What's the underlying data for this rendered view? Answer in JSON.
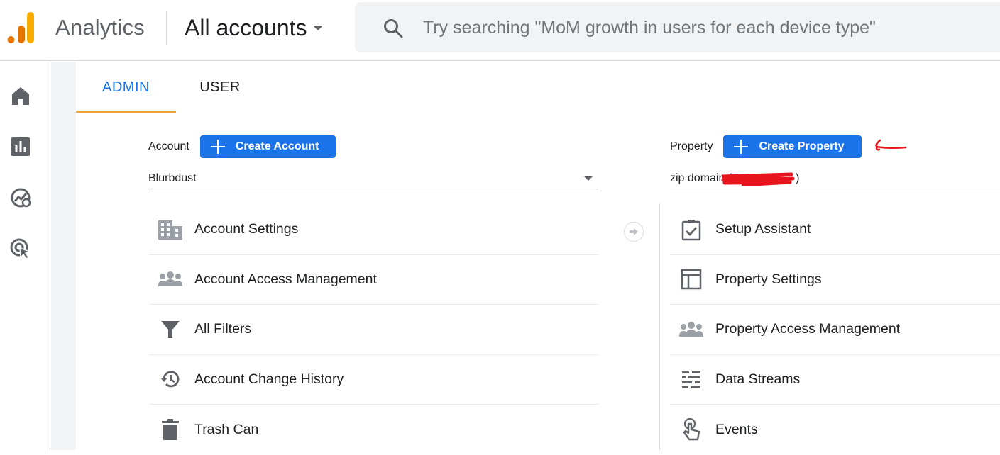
{
  "app": {
    "title": "Analytics",
    "account_picker": "All accounts",
    "search_placeholder": "Try searching \"MoM growth in users for each device type\"",
    "accent_color": "#1a73e8",
    "logo_colors": [
      "#f9ab00",
      "#e37400"
    ]
  },
  "rail": {
    "items": [
      {
        "icon": "home-icon"
      },
      {
        "icon": "reports-icon"
      },
      {
        "icon": "explore-icon"
      },
      {
        "icon": "advertising-icon"
      }
    ]
  },
  "tabs": {
    "admin": "ADMIN",
    "user": "USER",
    "active": "ADMIN"
  },
  "account": {
    "caption": "Account",
    "create_label": "Create Account",
    "selected": "Blurbdust",
    "items": [
      {
        "label": "Account Settings",
        "icon": "building-icon"
      },
      {
        "label": "Account Access Management",
        "icon": "people-icon"
      },
      {
        "label": "All Filters",
        "icon": "filter-icon"
      },
      {
        "label": "Account Change History",
        "icon": "history-icon"
      },
      {
        "label": "Trash Can",
        "icon": "trash-icon"
      }
    ]
  },
  "property": {
    "caption": "Property",
    "create_label": "Create Property",
    "selected_prefix": "zip domain (",
    "selected_suffix": ")",
    "items": [
      {
        "label": "Setup Assistant",
        "icon": "checklist-icon"
      },
      {
        "label": "Property Settings",
        "icon": "layout-icon"
      },
      {
        "label": "Property Access Management",
        "icon": "people-icon"
      },
      {
        "label": "Data Streams",
        "icon": "streams-icon"
      },
      {
        "label": "Events",
        "icon": "touch-icon"
      }
    ]
  },
  "annotation": {
    "color": "#e8141e"
  }
}
